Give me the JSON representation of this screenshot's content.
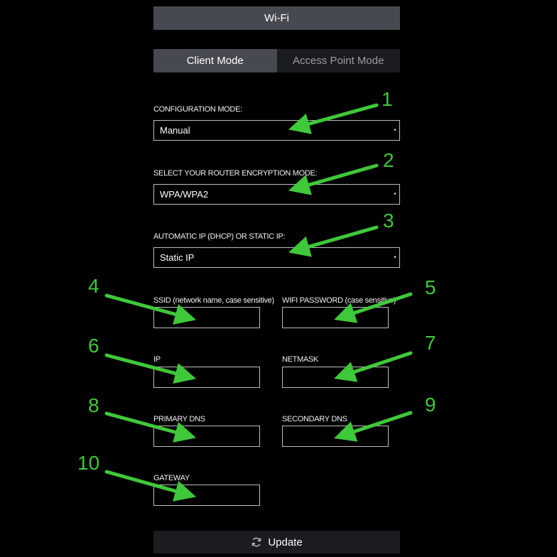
{
  "header": {
    "title": "Wi-Fi"
  },
  "tabs": [
    {
      "label": "Client Mode",
      "active": true
    },
    {
      "label": "Access Point Mode",
      "active": false
    }
  ],
  "selects": {
    "config_mode": {
      "label": "CONFIGURATION MODE:",
      "value": "Manual"
    },
    "encryption": {
      "label": "SELECT YOUR ROUTER ENCRYPTION MODE:",
      "value": "WPA/WPA2"
    },
    "ip_mode": {
      "label": "AUTOMATIC IP (DHCP) OR STATIC IP:",
      "value": "Static IP"
    }
  },
  "fields": {
    "ssid": {
      "label": "SSID (network name, case sensitive)",
      "value": ""
    },
    "password": {
      "label": "WIFI PASSWORD (case sensitive)",
      "value": ""
    },
    "ip": {
      "label": "IP",
      "value": ""
    },
    "netmask": {
      "label": "NETMASK",
      "value": ""
    },
    "primary_dns": {
      "label": "PRIMARY DNS",
      "value": ""
    },
    "secondary_dns": {
      "label": "SECONDARY DNS",
      "value": ""
    },
    "gateway": {
      "label": "GATEWAY",
      "value": ""
    }
  },
  "update_button": {
    "label": "Update",
    "icon": "refresh-icon"
  },
  "annotations": {
    "color": "#3fc83a",
    "numbers": [
      "1",
      "2",
      "3",
      "4",
      "5",
      "6",
      "7",
      "8",
      "9",
      "10"
    ]
  }
}
